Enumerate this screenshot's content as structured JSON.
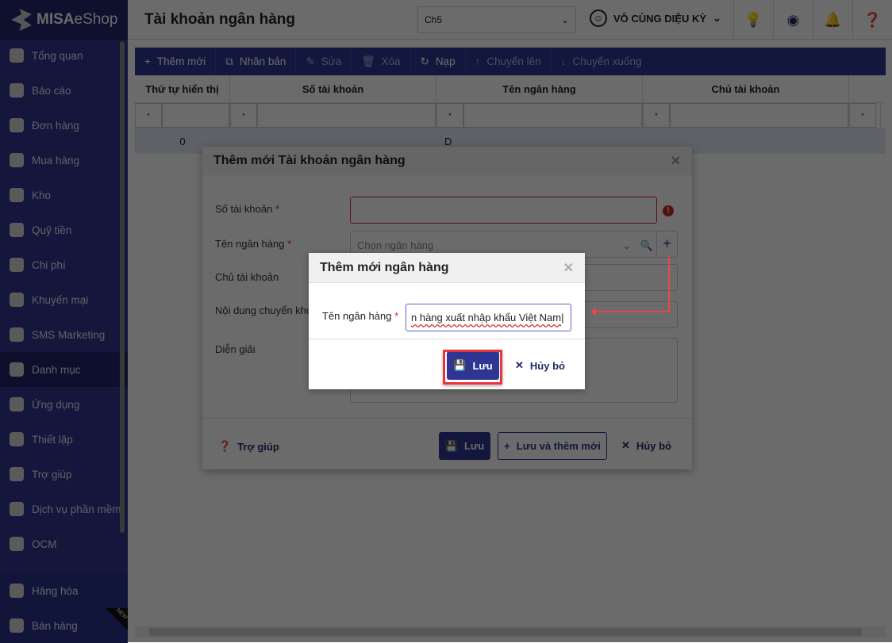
{
  "app": {
    "logo_text": "MISA",
    "logo_text2": "eShop"
  },
  "sidebar": {
    "items": [
      {
        "label": "Tổng quan",
        "icon": "dashboard-icon"
      },
      {
        "label": "Báo cáo",
        "icon": "pie-chart-icon"
      },
      {
        "label": "Đơn hàng",
        "icon": "order-icon"
      },
      {
        "label": "Mua hàng",
        "icon": "cart-icon"
      },
      {
        "label": "Kho",
        "icon": "warehouse-icon"
      },
      {
        "label": "Quỹ tiền",
        "icon": "safe-icon"
      },
      {
        "label": "Chi phí",
        "icon": "money-icon"
      },
      {
        "label": "Khuyến mại",
        "icon": "gift-icon"
      },
      {
        "label": "SMS Marketing",
        "icon": "phone-icon"
      },
      {
        "label": "Danh mục",
        "icon": "list-icon"
      },
      {
        "label": "Ứng dụng",
        "icon": "apps-icon"
      },
      {
        "label": "Thiết lập",
        "icon": "gear-icon"
      },
      {
        "label": "Trợ giúp",
        "icon": "help-icon"
      },
      {
        "label": "Dịch vụ phần mềm",
        "icon": "user-icon"
      },
      {
        "label": "OCM",
        "icon": "ocm-icon"
      }
    ],
    "bottom": [
      {
        "label": "Hàng hóa"
      },
      {
        "label": "Bán hàng"
      }
    ],
    "new_badge": "NEW"
  },
  "header": {
    "title": "Tài khoản ngân hàng",
    "branch": "Ch5",
    "user": "VÔ CÙNG DIỆU KỲ"
  },
  "toolbar": {
    "add": "Thêm mới",
    "duplicate": "Nhân bản",
    "edit": "Sửa",
    "delete": "Xóa",
    "reload": "Nạp",
    "move_up": "Chuyển lên",
    "move_down": "Chuyển xuống"
  },
  "grid": {
    "columns": [
      "Thứ tự hiển thị",
      "Số tài khoản",
      "Tên ngân hàng",
      "Chủ tài khoản"
    ],
    "filter_op": "*",
    "row": {
      "order": "0",
      "bank": "D"
    }
  },
  "dialog": {
    "title": "Thêm mới Tài khoản ngân hàng",
    "account_no": "Số tài khoản",
    "bank_name": "Tên ngân hàng",
    "bank_placeholder": "Chọn ngân hàng",
    "owner": "Chủ tài khoản",
    "transfer": "Nội dung chuyển khoản",
    "description": "Diễn giải",
    "help": "Trợ giúp",
    "save": "Lưu",
    "save_new": "Lưu và thêm mới",
    "cancel": "Hủy bỏ",
    "required": "*"
  },
  "modal": {
    "title": "Thêm mới ngân hàng",
    "label": "Tên ngân hàng",
    "value": "n hàng xuất nhập khẩu Việt Nam",
    "save": "Lưu",
    "cancel": "Hủy bỏ",
    "required": "*"
  }
}
